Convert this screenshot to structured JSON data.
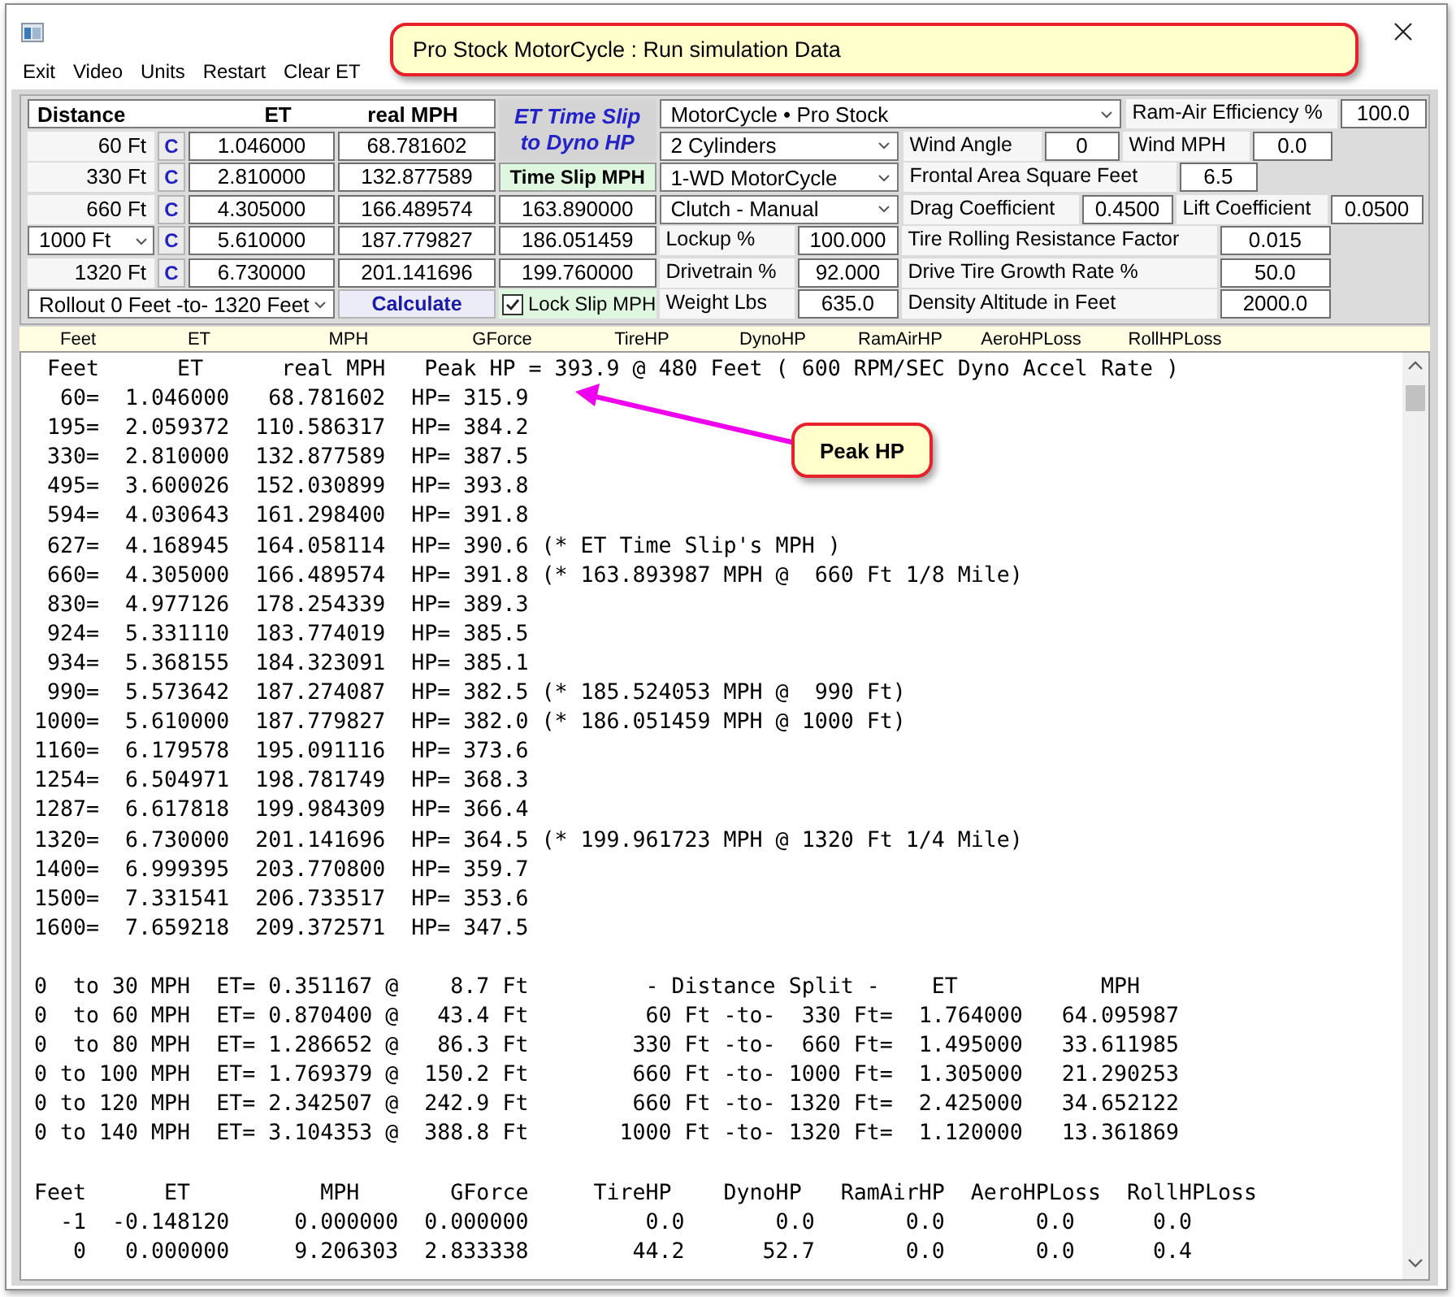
{
  "menu": [
    "Exit",
    "Video",
    "Units",
    "Restart",
    "Clear ET"
  ],
  "title_callout": "Pro Stock MotorCycle :  Run simulation Data",
  "timeslip": {
    "headers": [
      "Distance",
      "ET",
      "real MPH"
    ],
    "rows": [
      {
        "kind": "label",
        "distance": "60 Ft",
        "clear": "C",
        "et": "1.046000",
        "mph": "68.781602"
      },
      {
        "kind": "label",
        "distance": "330 Ft",
        "clear": "C",
        "et": "2.810000",
        "mph": "132.877589"
      },
      {
        "kind": "label",
        "distance": "660 Ft",
        "clear": "C",
        "et": "4.305000",
        "mph": "166.489574",
        "slip_mph": "163.890000"
      },
      {
        "kind": "dropdown",
        "distance": "1000 Ft",
        "clear": "C",
        "et": "5.610000",
        "mph": "187.779827",
        "slip_mph": "186.051459"
      },
      {
        "kind": "label",
        "distance": "1320 Ft",
        "clear": "C",
        "et": "6.730000",
        "mph": "201.141696",
        "slip_mph": "199.760000"
      }
    ],
    "rollout": "Rollout 0 Feet -to- 1320 Feet",
    "calculate": "Calculate"
  },
  "dyno": {
    "title_lines": [
      "ET Time Slip",
      "to Dyno HP"
    ],
    "slip_label": "Time Slip MPH",
    "lock": {
      "label": "Lock Slip MPH",
      "checked": true
    }
  },
  "settings_rows": [
    [
      {
        "kind": "select",
        "text": "MotorCycle • Pro Stock"
      },
      {
        "kind": "field",
        "label": "Ram-Air Efficiency %",
        "value": "100.0"
      }
    ],
    [
      {
        "kind": "select",
        "text": "2  Cylinders"
      },
      {
        "kind": "field",
        "label": "Wind Angle",
        "value": "0"
      },
      {
        "kind": "field",
        "label": "Wind MPH",
        "value": "0.0"
      }
    ],
    [
      {
        "kind": "select",
        "text": "1-WD MotorCycle"
      },
      {
        "kind": "field",
        "label": "Frontal Area Square Feet",
        "value": "6.5"
      }
    ],
    [
      {
        "kind": "select",
        "text": "Clutch - Manual"
      },
      {
        "kind": "field",
        "label": "Drag Coefficient",
        "value": "0.4500"
      },
      {
        "kind": "field",
        "label": "Lift Coefficient",
        "value": "0.0500"
      }
    ],
    [
      {
        "kind": "field",
        "label": "Lockup %",
        "value": "100.000"
      },
      {
        "kind": "field",
        "label": "Tire Rolling Resistance Factor",
        "value": "0.015"
      }
    ],
    [
      {
        "kind": "field",
        "label": "Drivetrain %",
        "value": "92.000"
      },
      {
        "kind": "field",
        "label": "Drive Tire Growth Rate %",
        "value": "50.0"
      }
    ],
    [
      {
        "kind": "field",
        "label": "Weight Lbs",
        "value": "635.0"
      },
      {
        "kind": "field",
        "label": "Density Altitude in Feet",
        "value": "2000.0"
      }
    ]
  ],
  "columns": [
    "Feet",
    "ET",
    "MPH",
    "GForce",
    "TireHP",
    "DynoHP",
    "RamAirHP",
    "AeroHPLoss",
    "RollHPLoss"
  ],
  "output": {
    "blocks": [
      [
        " Feet      ET      real MPH   Peak HP = 393.9 @ 480 Feet ( 600 RPM/SEC Dyno Accel Rate )",
        "  60=  1.046000   68.781602  HP= 315.9",
        " 195=  2.059372  110.586317  HP= 384.2",
        " 330=  2.810000  132.877589  HP= 387.5",
        " 495=  3.600026  152.030899  HP= 393.8",
        " 594=  4.030643  161.298400  HP= 391.8",
        " 627=  4.168945  164.058114  HP= 390.6 (* ET Time Slip's MPH )",
        " 660=  4.305000  166.489574  HP= 391.8 (* 163.893987 MPH @  660 Ft 1/8 Mile)",
        " 830=  4.977126  178.254339  HP= 389.3",
        " 924=  5.331110  183.774019  HP= 385.5",
        " 934=  5.368155  184.323091  HP= 385.1",
        " 990=  5.573642  187.274087  HP= 382.5 (* 185.524053 MPH @  990 Ft)",
        "1000=  5.610000  187.779827  HP= 382.0 (* 186.051459 MPH @ 1000 Ft)",
        "1160=  6.179578  195.091116  HP= 373.6",
        "1254=  6.504971  198.781749  HP= 368.3",
        "1287=  6.617818  199.984309  HP= 366.4",
        "1320=  6.730000  201.141696  HP= 364.5 (* 199.961723 MPH @ 1320 Ft 1/4 Mile)",
        "1400=  6.999395  203.770800  HP= 359.7",
        "1500=  7.331541  206.733517  HP= 353.6",
        "1600=  7.659218  209.372571  HP= 347.5"
      ],
      [
        "0  to 30 MPH  ET= 0.351167 @    8.7 Ft         - Distance Split -    ET           MPH",
        "0  to 60 MPH  ET= 0.870400 @   43.4 Ft         60 Ft -to-  330 Ft=  1.764000   64.095987",
        "0  to 80 MPH  ET= 1.286652 @   86.3 Ft        330 Ft -to-  660 Ft=  1.495000   33.611985",
        "0 to 100 MPH  ET= 1.769379 @  150.2 Ft        660 Ft -to- 1000 Ft=  1.305000   21.290253",
        "0 to 120 MPH  ET= 2.342507 @  242.9 Ft        660 Ft -to- 1320 Ft=  2.425000   34.652122",
        "0 to 140 MPH  ET= 3.104353 @  388.8 Ft       1000 Ft -to- 1320 Ft=  1.120000   13.361869"
      ],
      [
        "Feet      ET          MPH       GForce     TireHP    DynoHP   RamAirHP  AeroHPLoss  RollHPLoss",
        "  -1  -0.148120     0.000000  0.000000         0.0       0.0       0.0       0.0      0.0",
        "   0   0.000000     9.206303  2.833338        44.2      52.7       0.0       0.0      0.4"
      ]
    ]
  },
  "annotation": {
    "label": "Peak HP"
  }
}
